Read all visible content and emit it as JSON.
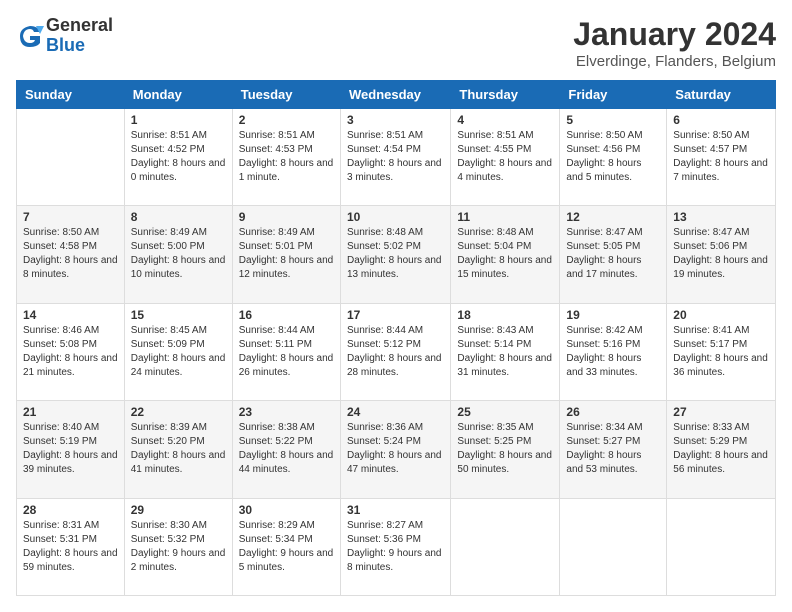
{
  "logo": {
    "general": "General",
    "blue": "Blue"
  },
  "title": "January 2024",
  "subtitle": "Elverdinge, Flanders, Belgium",
  "days_of_week": [
    "Sunday",
    "Monday",
    "Tuesday",
    "Wednesday",
    "Thursday",
    "Friday",
    "Saturday"
  ],
  "weeks": [
    [
      {
        "day": "",
        "sunrise": "",
        "sunset": "",
        "daylight": ""
      },
      {
        "day": "1",
        "sunrise": "Sunrise: 8:51 AM",
        "sunset": "Sunset: 4:52 PM",
        "daylight": "Daylight: 8 hours and 0 minutes."
      },
      {
        "day": "2",
        "sunrise": "Sunrise: 8:51 AM",
        "sunset": "Sunset: 4:53 PM",
        "daylight": "Daylight: 8 hours and 1 minute."
      },
      {
        "day": "3",
        "sunrise": "Sunrise: 8:51 AM",
        "sunset": "Sunset: 4:54 PM",
        "daylight": "Daylight: 8 hours and 3 minutes."
      },
      {
        "day": "4",
        "sunrise": "Sunrise: 8:51 AM",
        "sunset": "Sunset: 4:55 PM",
        "daylight": "Daylight: 8 hours and 4 minutes."
      },
      {
        "day": "5",
        "sunrise": "Sunrise: 8:50 AM",
        "sunset": "Sunset: 4:56 PM",
        "daylight": "Daylight: 8 hours and 5 minutes."
      },
      {
        "day": "6",
        "sunrise": "Sunrise: 8:50 AM",
        "sunset": "Sunset: 4:57 PM",
        "daylight": "Daylight: 8 hours and 7 minutes."
      }
    ],
    [
      {
        "day": "7",
        "sunrise": "Sunrise: 8:50 AM",
        "sunset": "Sunset: 4:58 PM",
        "daylight": "Daylight: 8 hours and 8 minutes."
      },
      {
        "day": "8",
        "sunrise": "Sunrise: 8:49 AM",
        "sunset": "Sunset: 5:00 PM",
        "daylight": "Daylight: 8 hours and 10 minutes."
      },
      {
        "day": "9",
        "sunrise": "Sunrise: 8:49 AM",
        "sunset": "Sunset: 5:01 PM",
        "daylight": "Daylight: 8 hours and 12 minutes."
      },
      {
        "day": "10",
        "sunrise": "Sunrise: 8:48 AM",
        "sunset": "Sunset: 5:02 PM",
        "daylight": "Daylight: 8 hours and 13 minutes."
      },
      {
        "day": "11",
        "sunrise": "Sunrise: 8:48 AM",
        "sunset": "Sunset: 5:04 PM",
        "daylight": "Daylight: 8 hours and 15 minutes."
      },
      {
        "day": "12",
        "sunrise": "Sunrise: 8:47 AM",
        "sunset": "Sunset: 5:05 PM",
        "daylight": "Daylight: 8 hours and 17 minutes."
      },
      {
        "day": "13",
        "sunrise": "Sunrise: 8:47 AM",
        "sunset": "Sunset: 5:06 PM",
        "daylight": "Daylight: 8 hours and 19 minutes."
      }
    ],
    [
      {
        "day": "14",
        "sunrise": "Sunrise: 8:46 AM",
        "sunset": "Sunset: 5:08 PM",
        "daylight": "Daylight: 8 hours and 21 minutes."
      },
      {
        "day": "15",
        "sunrise": "Sunrise: 8:45 AM",
        "sunset": "Sunset: 5:09 PM",
        "daylight": "Daylight: 8 hours and 24 minutes."
      },
      {
        "day": "16",
        "sunrise": "Sunrise: 8:44 AM",
        "sunset": "Sunset: 5:11 PM",
        "daylight": "Daylight: 8 hours and 26 minutes."
      },
      {
        "day": "17",
        "sunrise": "Sunrise: 8:44 AM",
        "sunset": "Sunset: 5:12 PM",
        "daylight": "Daylight: 8 hours and 28 minutes."
      },
      {
        "day": "18",
        "sunrise": "Sunrise: 8:43 AM",
        "sunset": "Sunset: 5:14 PM",
        "daylight": "Daylight: 8 hours and 31 minutes."
      },
      {
        "day": "19",
        "sunrise": "Sunrise: 8:42 AM",
        "sunset": "Sunset: 5:16 PM",
        "daylight": "Daylight: 8 hours and 33 minutes."
      },
      {
        "day": "20",
        "sunrise": "Sunrise: 8:41 AM",
        "sunset": "Sunset: 5:17 PM",
        "daylight": "Daylight: 8 hours and 36 minutes."
      }
    ],
    [
      {
        "day": "21",
        "sunrise": "Sunrise: 8:40 AM",
        "sunset": "Sunset: 5:19 PM",
        "daylight": "Daylight: 8 hours and 39 minutes."
      },
      {
        "day": "22",
        "sunrise": "Sunrise: 8:39 AM",
        "sunset": "Sunset: 5:20 PM",
        "daylight": "Daylight: 8 hours and 41 minutes."
      },
      {
        "day": "23",
        "sunrise": "Sunrise: 8:38 AM",
        "sunset": "Sunset: 5:22 PM",
        "daylight": "Daylight: 8 hours and 44 minutes."
      },
      {
        "day": "24",
        "sunrise": "Sunrise: 8:36 AM",
        "sunset": "Sunset: 5:24 PM",
        "daylight": "Daylight: 8 hours and 47 minutes."
      },
      {
        "day": "25",
        "sunrise": "Sunrise: 8:35 AM",
        "sunset": "Sunset: 5:25 PM",
        "daylight": "Daylight: 8 hours and 50 minutes."
      },
      {
        "day": "26",
        "sunrise": "Sunrise: 8:34 AM",
        "sunset": "Sunset: 5:27 PM",
        "daylight": "Daylight: 8 hours and 53 minutes."
      },
      {
        "day": "27",
        "sunrise": "Sunrise: 8:33 AM",
        "sunset": "Sunset: 5:29 PM",
        "daylight": "Daylight: 8 hours and 56 minutes."
      }
    ],
    [
      {
        "day": "28",
        "sunrise": "Sunrise: 8:31 AM",
        "sunset": "Sunset: 5:31 PM",
        "daylight": "Daylight: 8 hours and 59 minutes."
      },
      {
        "day": "29",
        "sunrise": "Sunrise: 8:30 AM",
        "sunset": "Sunset: 5:32 PM",
        "daylight": "Daylight: 9 hours and 2 minutes."
      },
      {
        "day": "30",
        "sunrise": "Sunrise: 8:29 AM",
        "sunset": "Sunset: 5:34 PM",
        "daylight": "Daylight: 9 hours and 5 minutes."
      },
      {
        "day": "31",
        "sunrise": "Sunrise: 8:27 AM",
        "sunset": "Sunset: 5:36 PM",
        "daylight": "Daylight: 9 hours and 8 minutes."
      },
      {
        "day": "",
        "sunrise": "",
        "sunset": "",
        "daylight": ""
      },
      {
        "day": "",
        "sunrise": "",
        "sunset": "",
        "daylight": ""
      },
      {
        "day": "",
        "sunrise": "",
        "sunset": "",
        "daylight": ""
      }
    ]
  ]
}
